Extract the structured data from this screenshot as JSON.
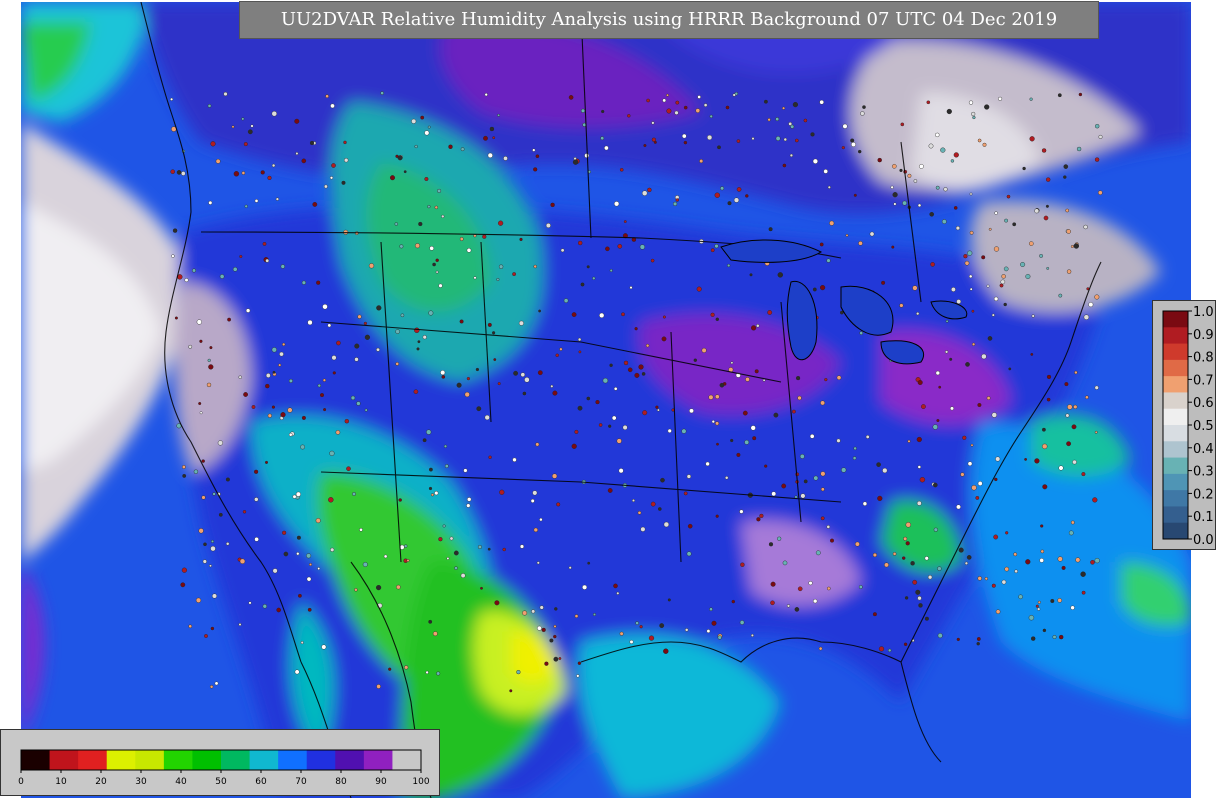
{
  "title": "UU2DVAR Relative Humidity Analysis using HRRR Background 07 UTC 04 Dec 2019",
  "observation_legend": {
    "ticks": [
      "1.0",
      "0.9",
      "0.8",
      "0.7",
      "0.6",
      "0.5",
      "0.4",
      "0.3",
      "0.2",
      "0.1",
      "0.0"
    ],
    "colors": [
      "#7a0a12",
      "#b01c22",
      "#cf3a2c",
      "#e06a46",
      "#f0a070",
      "#d9d2cc",
      "#efefef",
      "#d8dde2",
      "#aec4cf",
      "#68b2b4",
      "#4f95b5",
      "#3f78a6",
      "#345f8f",
      "#284872"
    ]
  },
  "humidity_legend": {
    "ticks": [
      "0",
      "10",
      "20",
      "30",
      "40",
      "50",
      "60",
      "70",
      "80",
      "90",
      "100"
    ],
    "colors": [
      "#1a0000",
      "#c0141c",
      "#e02020",
      "#dcf000",
      "#c8e800",
      "#22d400",
      "#00c000",
      "#00b860",
      "#10b8d0",
      "#1070ff",
      "#2030e0",
      "#5010b0",
      "#9020c0",
      "#c8c8c8"
    ]
  }
}
